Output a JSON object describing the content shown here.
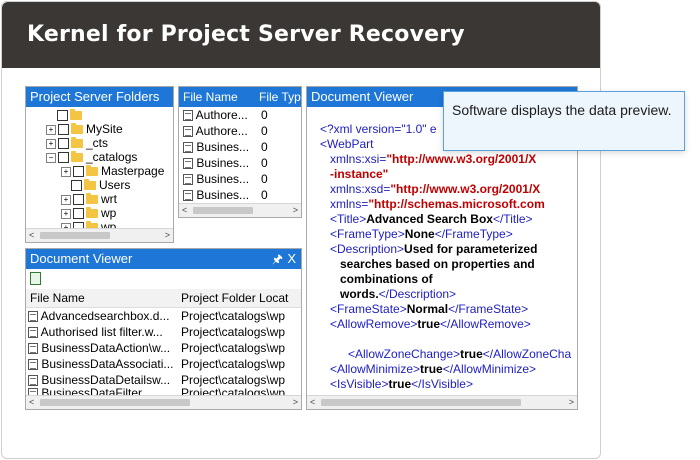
{
  "header": {
    "title": "Kernel for Project Server Recovery"
  },
  "folders_panel": {
    "title": "Project Server Folders",
    "nodes": [
      {
        "label": ""
      },
      {
        "label": "MySite"
      },
      {
        "label": "_cts"
      },
      {
        "label": "_catalogs"
      },
      {
        "label": "Masterpage"
      },
      {
        "label": "Users"
      },
      {
        "label": "wrt"
      },
      {
        "label": "wp"
      },
      {
        "label": "wp"
      }
    ]
  },
  "files_panel": {
    "col_name": "File Name",
    "col_type": "File Typ",
    "rows": [
      {
        "name": "Authore...",
        "type": "0"
      },
      {
        "name": "Authore...",
        "type": "0"
      },
      {
        "name": "Busines...",
        "type": "0"
      },
      {
        "name": "Busines...",
        "type": "0"
      },
      {
        "name": "Busines...",
        "type": "0"
      },
      {
        "name": "Busines...",
        "type": "0"
      }
    ]
  },
  "doc_viewer_bottom": {
    "title": "Document Viewer",
    "pin_icon": "pin-icon",
    "close_label": "X",
    "col_name": "File Name",
    "col_location": "Project Folder Locat",
    "rows": [
      {
        "name": "Advancedsearchbox.d...",
        "location": "Project\\catalogs\\wp"
      },
      {
        "name": "Authorised list filter.w...",
        "location": "Project\\catalogs\\wp"
      },
      {
        "name": "BusinessDataAction\\w...",
        "location": "Project\\catalogs\\wp"
      },
      {
        "name": "BusinessDataAssociati...",
        "location": "Project\\catalogs\\wp"
      },
      {
        "name": "BusinessDataDetailsw...",
        "location": "Project\\catalogs\\wp"
      },
      {
        "name": "BusinessDataFilter",
        "location": "Project\\catalogs\\wp"
      }
    ]
  },
  "doc_viewer_main": {
    "title": "Document Viewer",
    "xml": {
      "l1a": "<?xml version=\"1.0\" e",
      "l2": "<WebPart",
      "l3a": "xmlns:xsi=",
      "l3b": "\"http://www.w3.org/2001/X",
      "l4": "-instance\"",
      "l5a": "xmlns:xsd=",
      "l5b": "\"http://www.w3.org/2001/X",
      "l6a": "xmlns=",
      "l6b": "\"http://schemas.microsoft.com",
      "title_open": "<Title>",
      "title_val": "Advanced Search Box",
      "title_close": "</Title>",
      "ft_open": "<FrameType>",
      "ft_val": "None",
      "ft_close": "</FrameType>",
      "desc_open": "<Description>",
      "desc_val1": "Used for parameterized",
      "desc_val2": "searches based on properties and",
      "desc_val3": "combinations of",
      "desc_val4": "words.",
      "desc_close": "</Description>",
      "fs_open": "<FrameState>",
      "fs_val": "Normal",
      "fs_close": "</FrameState>",
      "ar_open": "<AllowRemove>",
      "ar_val": "true",
      "ar_close": "</AllowRemove>",
      "azc_open": "<AllowZoneChange>",
      "azc_val": "true",
      "azc_close": "</AllowZoneCha",
      "am_open": "<AllowMinimize>",
      "am_val": "true",
      "am_close": "</AllowMinimize>",
      "iv_open": "<IsVisible>",
      "iv_val": "true",
      "iv_close": "</IsVisible>"
    }
  },
  "tooltip": {
    "text": "Software displays the data preview."
  },
  "colors": {
    "header_bg": "#3b3735",
    "panel_title": "#1e76d6",
    "tag": "#2020c0",
    "attr_value": "#c00000"
  }
}
